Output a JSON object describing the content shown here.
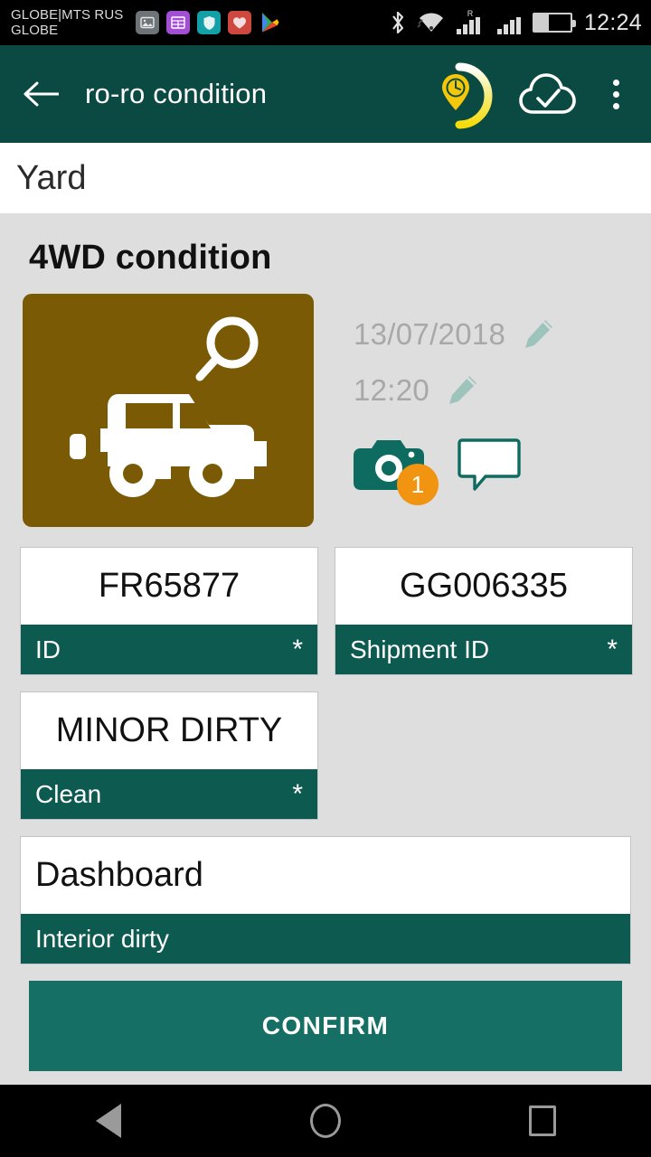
{
  "status_bar": {
    "carrier_line1": "GLOBE|MTS RUS",
    "carrier_line2": "GLOBE",
    "clock": "12:24",
    "icons": [
      "photos-icon",
      "list-icon",
      "shield-icon",
      "heart-icon",
      "play-store-icon"
    ],
    "right_icons": [
      "bluetooth-icon",
      "wifi-icon",
      "signal-roaming-icon",
      "signal-icon",
      "battery-icon"
    ],
    "roaming_label": "R"
  },
  "app_bar": {
    "back_label": "←",
    "title": "ro-ro condition",
    "actions": [
      "location-clock-icon",
      "cloud-check-icon",
      "overflow-menu-icon"
    ]
  },
  "breadcrumb": {
    "label": "Yard"
  },
  "section": {
    "title": "4WD condition"
  },
  "vehicle_card": {
    "icons": [
      "magnifier-icon",
      "suv-vehicle-icon"
    ],
    "background_color": "#7a5a05"
  },
  "meta": {
    "date": "13/07/2018",
    "time": "12:20",
    "edit_icon": "pencil-icon",
    "photo_count": "1",
    "camera_icon": "camera-icon",
    "comment_icon": "comment-bubble-icon"
  },
  "fields": [
    {
      "value": "FR65877",
      "label": "ID",
      "required": "*",
      "align": "center",
      "width": "half"
    },
    {
      "value": "GG006335",
      "label": "Shipment ID",
      "required": "*",
      "align": "center",
      "width": "half"
    },
    {
      "value": "MINOR DIRTY",
      "label": "Clean",
      "required": "*",
      "align": "center",
      "width": "half"
    },
    {
      "value": "Dashboard",
      "label": "Interior dirty",
      "required": "",
      "align": "left",
      "width": "full"
    }
  ],
  "confirm_button": {
    "label": "CONFIRM"
  },
  "nav_bar": {
    "items": [
      "back-nav-button",
      "home-nav-button",
      "recents-nav-button"
    ]
  },
  "colors": {
    "app_bar": "#0b4a42",
    "label_bar": "#0d5a50",
    "confirm": "#166f64",
    "page_bg": "#dedede",
    "card_brown": "#7a5a05",
    "badge_orange": "#f09411",
    "accent_yellow": "#f2d40c"
  }
}
